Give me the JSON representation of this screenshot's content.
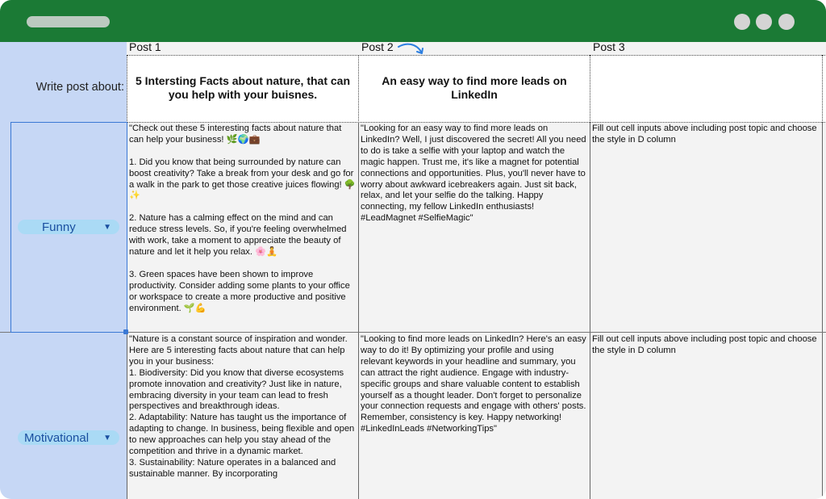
{
  "columns": [
    "Post 1",
    "Post 2",
    "Post 3"
  ],
  "row_label": "Write post about:",
  "topics": [
    "5 Intersting Facts about nature, that can you help with your buisnes.",
    "An easy way to find more leads on LinkedIn",
    ""
  ],
  "styles": [
    {
      "label": "Funny"
    },
    {
      "label": "Motivational"
    }
  ],
  "cells": {
    "funny": [
      "\"Check out these 5 interesting facts about nature that can help your business! 🌿🌍💼\n\n1. Did you know that being surrounded by nature can boost creativity? Take a break from your desk and go for a walk in the park to get those creative juices flowing! 🌳✨\n\n2. Nature has a calming effect on the mind and can reduce stress levels. So, if you're feeling overwhelmed with work, take a moment to appreciate the beauty of nature and let it help you relax. 🌸🧘\n\n3. Green spaces have been shown to improve productivity. Consider adding some plants to your office or workspace to create a more productive and positive environment. 🌱💪",
      "\"Looking for an easy way to find more leads on LinkedIn? Well, I just discovered the secret! All you need to do is take a selfie with your laptop and watch the magic happen. Trust me, it's like a magnet for potential connections and opportunities. Plus, you'll never have to worry about awkward icebreakers again. Just sit back, relax, and let your selfie do the talking. Happy connecting, my fellow LinkedIn enthusiasts! #LeadMagnet #SelfieMagic\"",
      "Fill out cell inputs above including post topic and choose the style in D column"
    ],
    "motivational": [
      "\"Nature is a constant source of inspiration and wonder. Here are 5 interesting facts about nature that can help you in your business:\n1. Biodiversity: Did you know that diverse ecosystems promote innovation and creativity? Just like in nature, embracing diversity in your team can lead to fresh perspectives and breakthrough ideas.\n2. Adaptability: Nature has taught us the importance of adapting to change. In business, being flexible and open to new approaches can help you stay ahead of the competition and thrive in a dynamic market.\n3. Sustainability: Nature operates in a balanced and sustainable manner. By incorporating",
      "\"Looking to find more leads on LinkedIn? Here's an easy way to do it! By optimizing your profile and using relevant keywords in your headline and summary, you can attract the right audience. Engage with industry-specific groups and share valuable content to establish yourself as a thought leader. Don't forget to personalize your connection requests and engage with others' posts. Remember, consistency is key. Happy networking! #LinkedInLeads #NetworkingTips\"",
      "Fill out cell inputs above including post topic and choose the style in D column"
    ]
  },
  "icons": {
    "arrow": "curved-arrow-icon",
    "caret": "caret-down-icon"
  },
  "colors": {
    "titlebar": "#1b7a35",
    "left_panel": "#c6d7f5",
    "chip": "#aadaf5",
    "selection": "#3a78d4"
  }
}
